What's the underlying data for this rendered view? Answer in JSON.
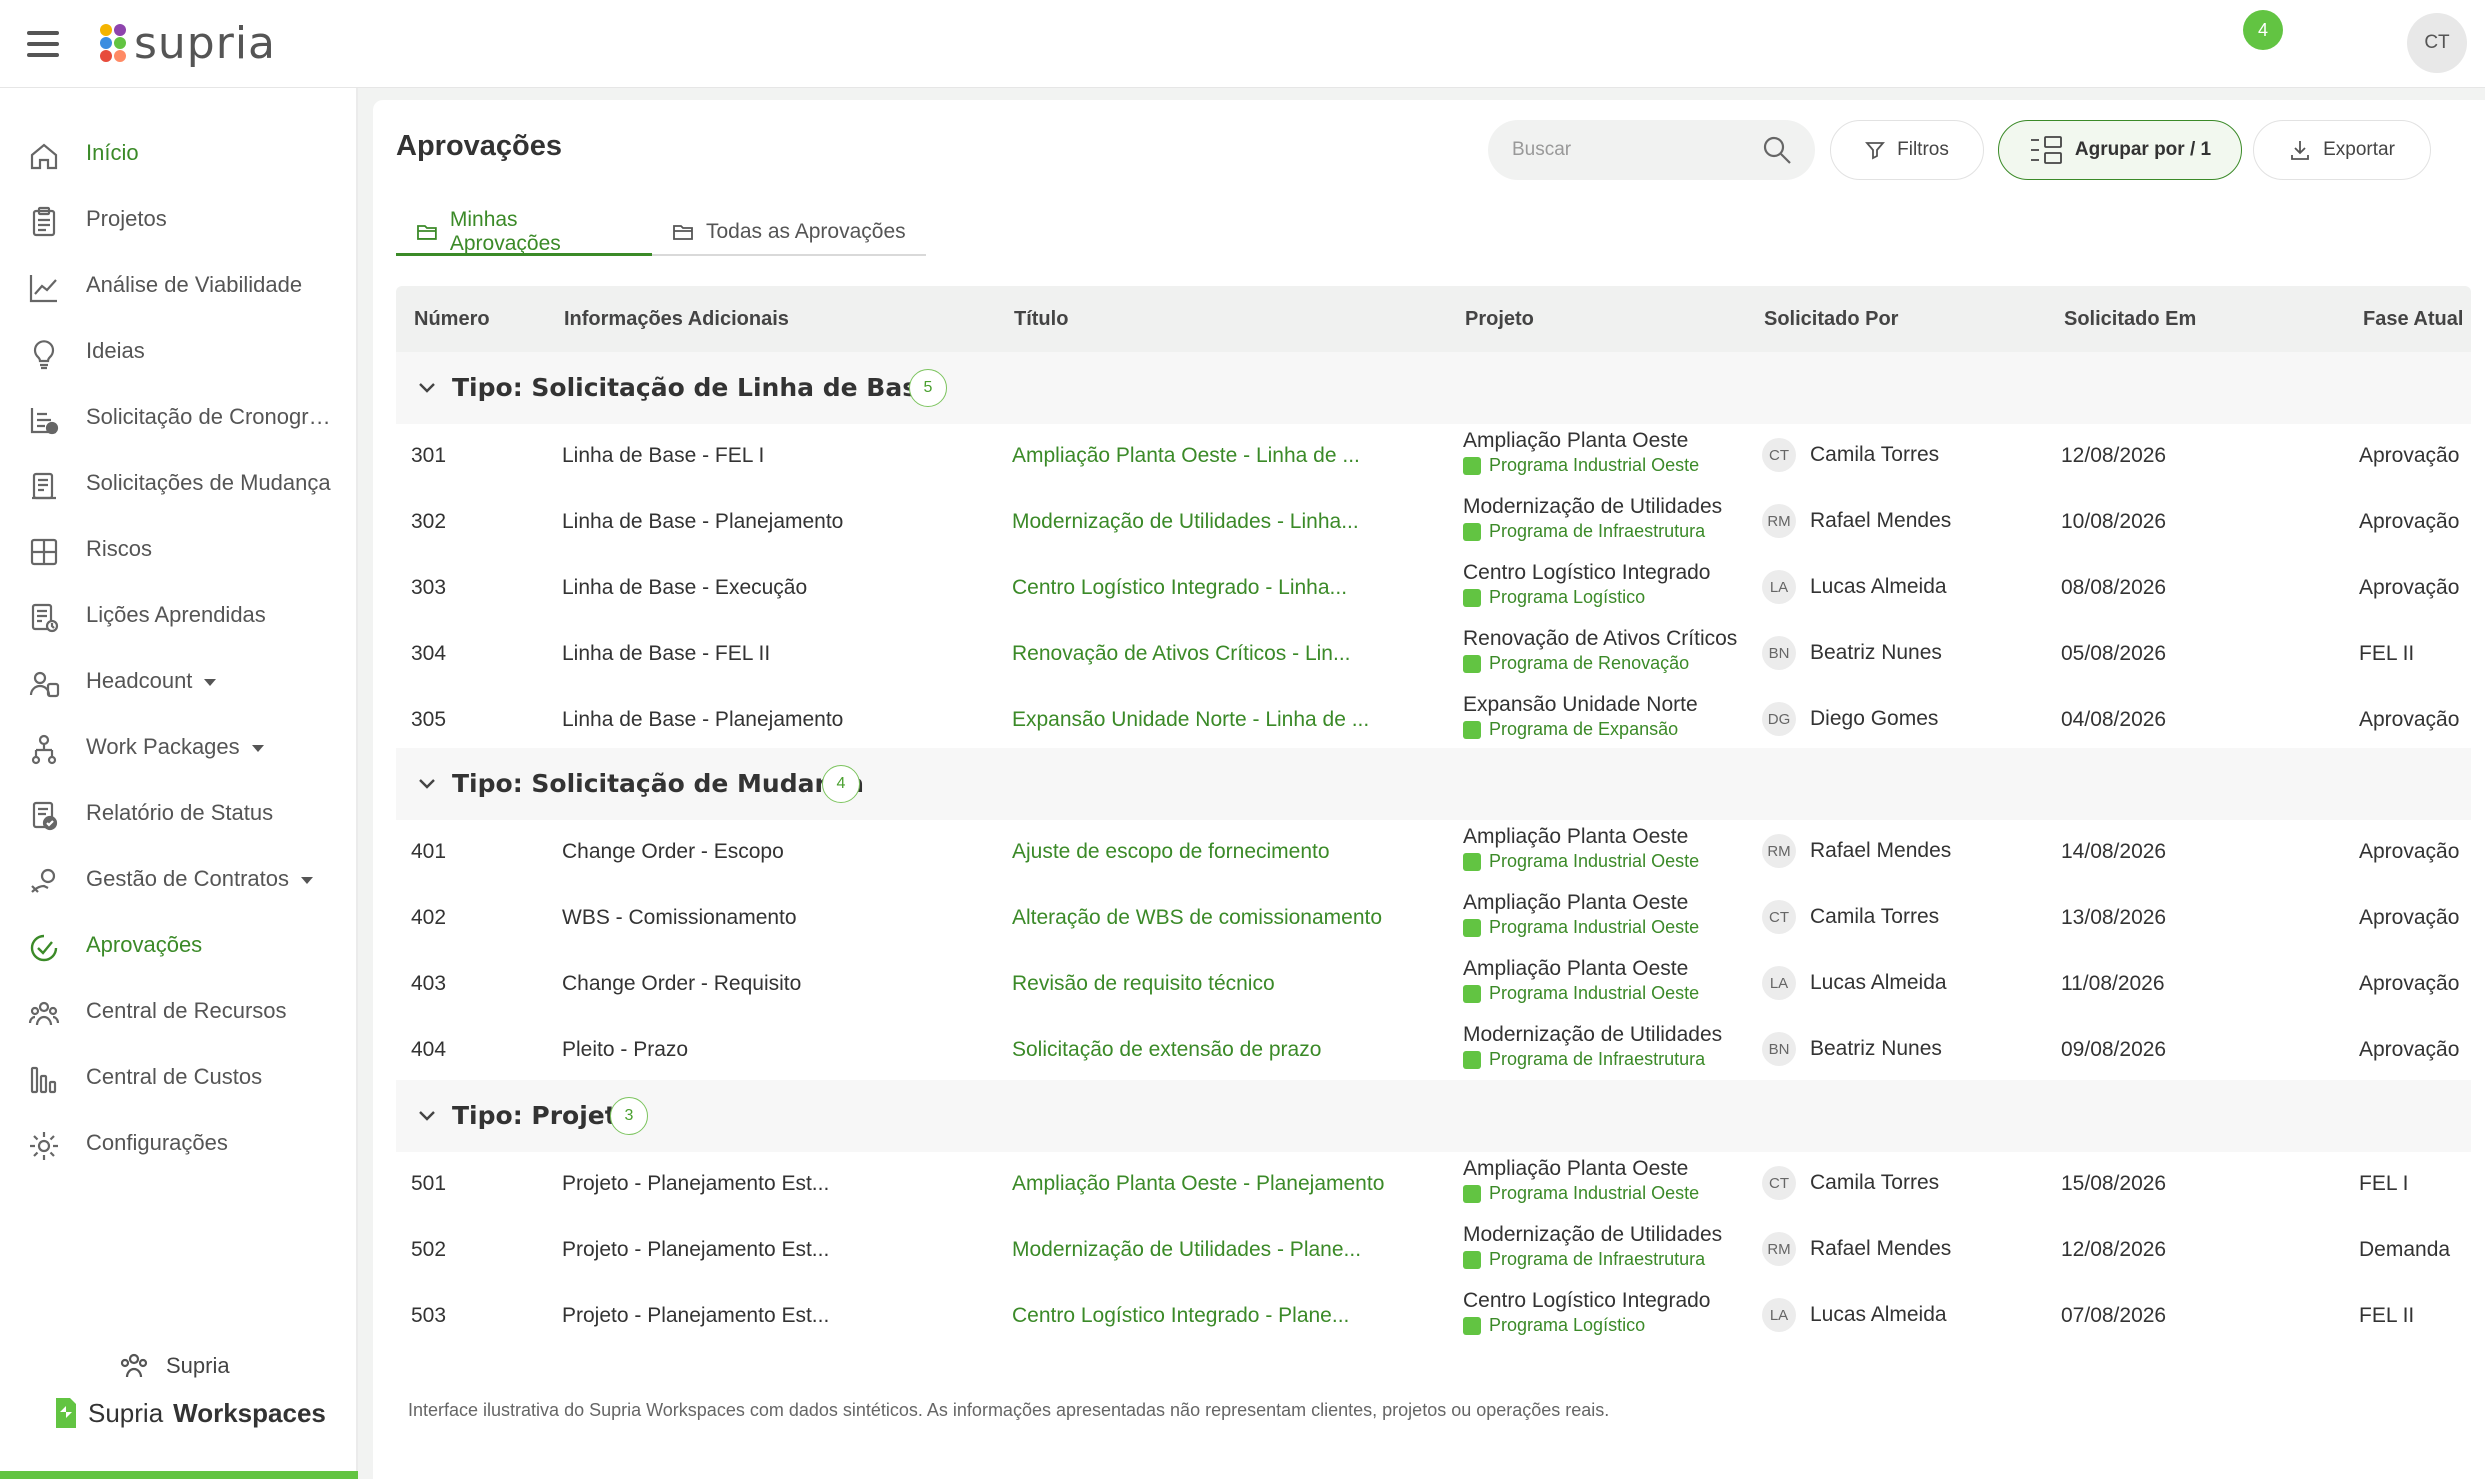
{
  "app": {
    "name": "supria",
    "notifications": "4",
    "user_initials": "CT"
  },
  "sidebar": {
    "items": [
      {
        "label": "Início",
        "icon": "home-icon"
      },
      {
        "label": "Projetos",
        "icon": "clipboard-icon"
      },
      {
        "label": "Análise de Viabilidade",
        "icon": "trend-chart-icon"
      },
      {
        "label": "Ideias",
        "icon": "lightbulb-icon"
      },
      {
        "label": "Solicitação de Cronograma",
        "icon": "schedule-request-icon"
      },
      {
        "label": "Solicitações de Mudança",
        "icon": "change-request-icon"
      },
      {
        "label": "Riscos",
        "icon": "risk-grid-icon"
      },
      {
        "label": "Lições Aprendidas",
        "icon": "lessons-icon"
      },
      {
        "label": "Headcount",
        "icon": "people-icon"
      },
      {
        "label": "Work Packages",
        "icon": "work-packages-icon"
      },
      {
        "label": "Relatório de Status",
        "icon": "status-report-icon"
      },
      {
        "label": "Gestão de Contratos",
        "icon": "contracts-icon"
      },
      {
        "label": "Aprovações",
        "icon": "approval-icon"
      },
      {
        "label": "Central de Recursos",
        "icon": "resources-icon"
      },
      {
        "label": "Central de Custos",
        "icon": "costs-bar-icon"
      },
      {
        "label": "Configurações",
        "icon": "gear-icon"
      }
    ],
    "org_name": "Supria",
    "brand_prefix": "Supria",
    "brand_suffix": "Workspaces"
  },
  "page": {
    "title": "Aprovações",
    "search_placeholder": "Buscar",
    "filters_label": "Filtros",
    "group_by_label": "Agrupar por / 1",
    "export_label": "Exportar",
    "tabs": [
      {
        "label": "Minhas Aprovações",
        "active": true
      },
      {
        "label": "Todas as Aprovações",
        "active": false
      }
    ]
  },
  "table": {
    "columns": [
      "Número",
      "Informações Adicionais",
      "Título",
      "Projeto",
      "Solicitado Por",
      "Solicitado Em",
      "Fase Atual"
    ],
    "groups": [
      {
        "label": "Tipo: Solicitação de Linha de Base",
        "count": "5",
        "rows": [
          {
            "num": "301",
            "info": "Linha de Base - FEL I",
            "title": "Ampliação Planta Oeste - Linha de ...",
            "project": "Ampliação Planta Oeste",
            "program": "Programa Industrial Oeste",
            "initials": "CT",
            "user": "Camila Torres",
            "date": "12/08/2026",
            "phase": "Aprovação"
          },
          {
            "num": "302",
            "info": "Linha de Base - Planejamento",
            "title": "Modernização de Utilidades - Linha...",
            "project": "Modernização de Utilidades",
            "program": "Programa de Infraestrutura",
            "initials": "RM",
            "user": "Rafael Mendes",
            "date": "10/08/2026",
            "phase": "Aprovação"
          },
          {
            "num": "303",
            "info": "Linha de Base - Execução",
            "title": "Centro Logístico Integrado - Linha...",
            "project": "Centro Logístico Integrado",
            "program": "Programa Logístico",
            "initials": "LA",
            "user": "Lucas Almeida",
            "date": "08/08/2026",
            "phase": "Aprovação"
          },
          {
            "num": "304",
            "info": "Linha de Base - FEL II",
            "title": "Renovação de Ativos Críticos - Lin...",
            "project": "Renovação de Ativos Críticos",
            "program": "Programa de Renovação",
            "initials": "BN",
            "user": "Beatriz Nunes",
            "date": "05/08/2026",
            "phase": "FEL II"
          },
          {
            "num": "305",
            "info": "Linha de Base - Planejamento",
            "title": "Expansão Unidade Norte - Linha de ...",
            "project": "Expansão Unidade Norte",
            "program": "Programa de Expansão",
            "initials": "DG",
            "user": "Diego Gomes",
            "date": "04/08/2026",
            "phase": "Aprovação"
          }
        ]
      },
      {
        "label": "Tipo: Solicitação de Mudança",
        "count": "4",
        "rows": [
          {
            "num": "401",
            "info": "Change Order - Escopo",
            "title": "Ajuste de escopo de fornecimento",
            "project": "Ampliação Planta Oeste",
            "program": "Programa Industrial Oeste",
            "initials": "RM",
            "user": "Rafael Mendes",
            "date": "14/08/2026",
            "phase": "Aprovação"
          },
          {
            "num": "402",
            "info": "WBS - Comissionamento",
            "title": "Alteração de WBS de comissionamento",
            "project": "Ampliação Planta Oeste",
            "program": "Programa Industrial Oeste",
            "initials": "CT",
            "user": "Camila Torres",
            "date": "13/08/2026",
            "phase": "Aprovação"
          },
          {
            "num": "403",
            "info": "Change Order - Requisito",
            "title": "Revisão de requisito técnico",
            "project": "Ampliação Planta Oeste",
            "program": "Programa Industrial Oeste",
            "initials": "LA",
            "user": "Lucas Almeida",
            "date": "11/08/2026",
            "phase": "Aprovação"
          },
          {
            "num": "404",
            "info": "Pleito - Prazo",
            "title": "Solicitação de extensão de prazo",
            "project": "Modernização de Utilidades",
            "program": "Programa de Infraestrutura",
            "initials": "BN",
            "user": "Beatriz Nunes",
            "date": "09/08/2026",
            "phase": "Aprovação"
          }
        ]
      },
      {
        "label": "Tipo: Projeto",
        "count": "3",
        "rows": [
          {
            "num": "501",
            "info": "Projeto - Planejamento Est...",
            "title": "Ampliação Planta Oeste - Planejamento",
            "project": "Ampliação Planta Oeste",
            "program": "Programa Industrial Oeste",
            "initials": "CT",
            "user": "Camila Torres",
            "date": "15/08/2026",
            "phase": "FEL I"
          },
          {
            "num": "502",
            "info": "Projeto - Planejamento Est...",
            "title": "Modernização de Utilidades - Plane...",
            "project": "Modernização de Utilidades",
            "program": "Programa de Infraestrutura",
            "initials": "RM",
            "user": "Rafael Mendes",
            "date": "12/08/2026",
            "phase": "Demanda"
          },
          {
            "num": "503",
            "info": "Projeto - Planejamento Est...",
            "title": "Centro Logístico Integrado - Plane...",
            "project": "Centro Logístico Integrado",
            "program": "Programa Logístico",
            "initials": "LA",
            "user": "Lucas Almeida",
            "date": "07/08/2026",
            "phase": "FEL II"
          }
        ]
      }
    ]
  },
  "footnote": "Interface ilustrativa do Supria Workspaces com dados sintéticos. As informações apresentadas não representam clientes, projetos ou operações reais.",
  "colors": {
    "accent": "#3b8a28",
    "brand_green": "#62c442",
    "text": "#333333"
  }
}
